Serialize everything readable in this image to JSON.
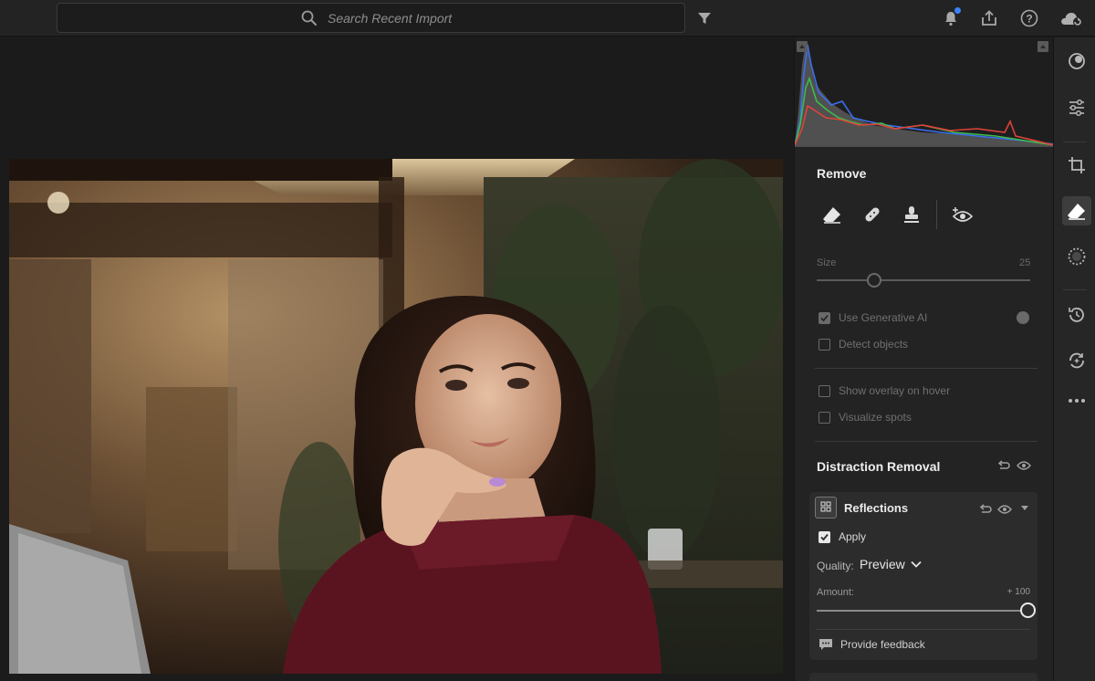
{
  "search": {
    "placeholder": "Search Recent Import"
  },
  "topbar": {
    "icons": [
      "filter-icon",
      "bell-icon",
      "share-icon",
      "help-icon",
      "cloud-sync-icon"
    ]
  },
  "remove_panel": {
    "title": "Remove",
    "tools": [
      "eraser-icon",
      "bandage-icon",
      "clone-stamp-icon",
      "visualize-spots-icon"
    ],
    "size_label": "Size",
    "size_value": "25",
    "use_generative_ai": {
      "label": "Use Generative AI",
      "checked": true
    },
    "detect_objects": {
      "label": "Detect objects",
      "checked": false
    },
    "show_overlay": {
      "label": "Show overlay on hover",
      "checked": false
    },
    "visualize_spots": {
      "label": "Visualize spots",
      "checked": false
    }
  },
  "distraction_removal": {
    "title": "Distraction Removal",
    "reflections": {
      "title": "Reflections",
      "apply_label": "Apply",
      "apply_checked": true,
      "quality_label": "Quality:",
      "quality_value": "Preview",
      "amount_label": "Amount:",
      "amount_value": "+ 100",
      "amount_level": 1.0,
      "feedback_label": "Provide feedback"
    }
  },
  "rail": {
    "icons": [
      "presets-icon",
      "edit-sliders-icon",
      "crop-icon",
      "remove-eraser-icon",
      "masking-icon",
      "history-icon",
      "versions-icon",
      "more-icon"
    ],
    "active": "remove-eraser-icon"
  },
  "colors": {
    "accent_blue": "#3b82f6",
    "panel_bg": "#232323",
    "canvas_bg": "#1b1b1b"
  }
}
